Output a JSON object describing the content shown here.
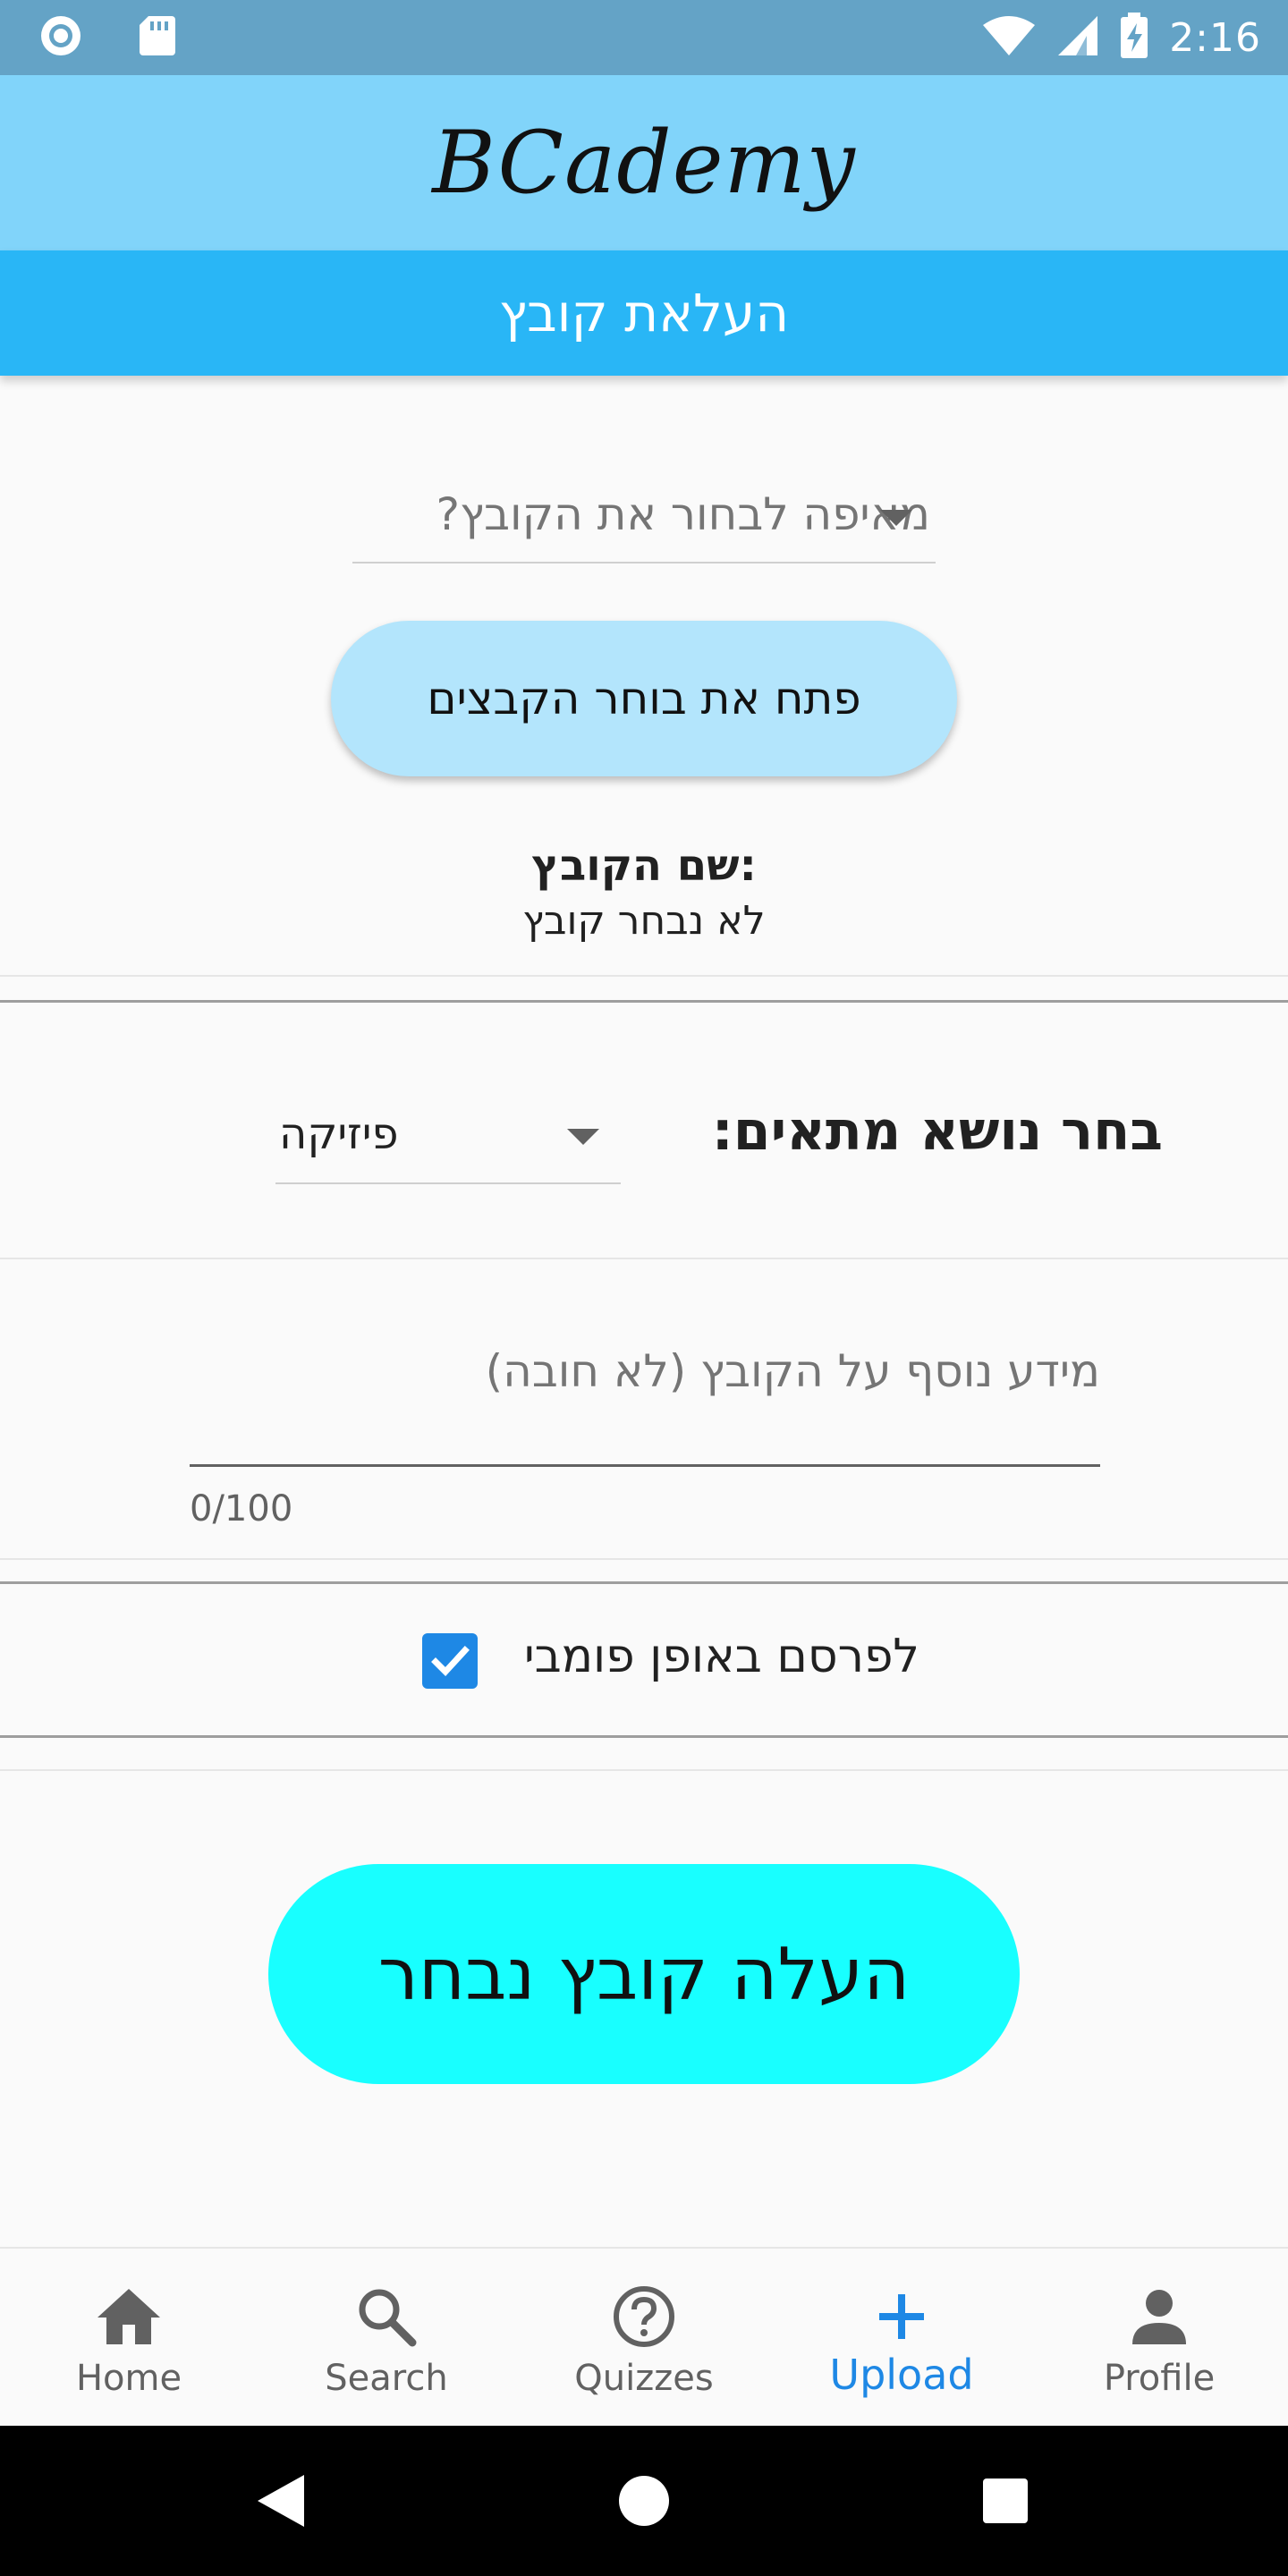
{
  "status_bar": {
    "time": "2:16",
    "icons": [
      "circle-status-icon",
      "sd-card-icon",
      "wifi-icon",
      "signal-icon",
      "battery-charging-icon"
    ]
  },
  "app_bar": {
    "title": "BCademy"
  },
  "page": {
    "title": "העלאת קובץ"
  },
  "form": {
    "source_dropdown": {
      "placeholder": "מאיפה לבחור את הקובץ?"
    },
    "open_picker_button": "פתח את בוחר הקבצים",
    "file_name_label": "שם הקובץ:",
    "file_name_value": "לא נבחר קובץ",
    "subject": {
      "label": "בחר נושא מתאים:",
      "selected": "פיזיקה"
    },
    "description": {
      "placeholder": "מידע נוסף על הקובץ (לא חובה)",
      "counter": "0/100"
    },
    "publish_public": {
      "label": "לפרסם באופן פומבי",
      "checked": true
    },
    "upload_button": "העלה קובץ נבחר"
  },
  "bottom_nav": {
    "active": "upload",
    "items": [
      {
        "id": "home",
        "label": "Home",
        "icon": "home-icon"
      },
      {
        "id": "search",
        "label": "Search",
        "icon": "search-icon"
      },
      {
        "id": "quizzes",
        "label": "Quizzes",
        "icon": "help-circle-icon"
      },
      {
        "id": "upload",
        "label": "Upload",
        "icon": "plus-icon"
      },
      {
        "id": "profile",
        "label": "Profile",
        "icon": "person-icon"
      }
    ]
  },
  "system_nav": {
    "icons": [
      "back-icon",
      "home-circle-icon",
      "recents-icon"
    ]
  },
  "colors": {
    "status_bar": "#64a3c6",
    "app_bar": "#81d4fa",
    "sub_header": "#29b6f6",
    "picker_button": "#b3e5fc",
    "upload_button": "#18ffff",
    "checkbox": "#1e88e5",
    "active_nav": "#1e88e5"
  }
}
